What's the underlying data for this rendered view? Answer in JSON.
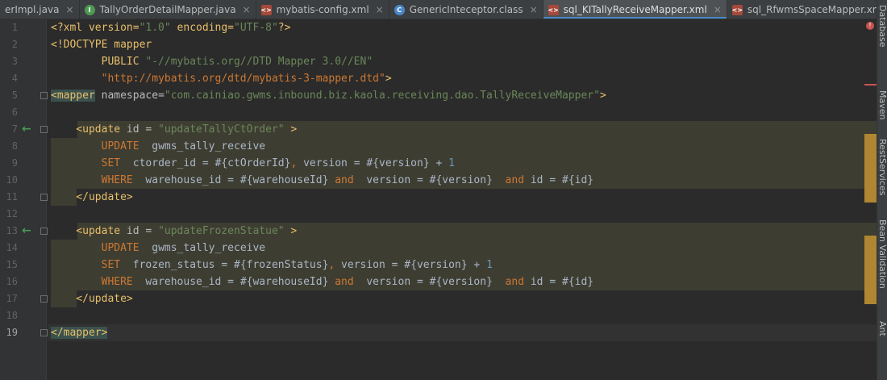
{
  "tabs": [
    {
      "label": "erImpl.java",
      "icon": "java-class-icon",
      "active": false
    },
    {
      "label": "TallyOrderDetailMapper.java",
      "icon": "java-interface-icon",
      "active": false
    },
    {
      "label": "mybatis-config.xml",
      "icon": "xml-file-icon",
      "active": false
    },
    {
      "label": "GenericInteceptor.class",
      "icon": "class-file-icon",
      "active": false
    },
    {
      "label": "sql_KITallyReceiveMapper.xml",
      "icon": "xml-file-icon",
      "active": true
    },
    {
      "label": "sql_RfwmsSpaceMapper.xml",
      "icon": "xml-file-icon",
      "active": false
    }
  ],
  "close_glyph": "×",
  "line_numbers": [
    "1",
    "2",
    "3",
    "4",
    "5",
    "6",
    "7",
    "8",
    "9",
    "10",
    "11",
    "12",
    "13",
    "14",
    "15",
    "16",
    "17",
    "18",
    "19"
  ],
  "code": {
    "l1": {
      "a": "<?xml version=",
      "b": "\"1.0\"",
      "c": " encoding=",
      "d": "\"UTF-8\"",
      "e": "?>"
    },
    "l2": {
      "a": "<!DOCTYPE mapper"
    },
    "l3": {
      "a": "        PUBLIC ",
      "b": "\"-//mybatis.org//DTD Mapper 3.0//EN\""
    },
    "l4": {
      "a": "        ",
      "b": "\"http://mybatis.org/dtd/mybatis-3-mapper.dtd\"",
      "c": ">"
    },
    "l5": {
      "a": "<mapper",
      "b": " namespace=",
      "c": "\"com.cainiao.gwms.inbound.biz.kaola.receiving.dao.TallyReceiveMapper\"",
      "d": ">"
    },
    "l7": {
      "a": "    <update",
      "b": " id ",
      "c": "= ",
      "d": "\"updateTallyCtOrder\"",
      "e": " >"
    },
    "l8": {
      "a": "        ",
      "b": "UPDATE",
      "c": "  gwms_tally_receive"
    },
    "l9": {
      "a": "        ",
      "b": "SET",
      "c": "  ctorder_id = #{ctOrderId}",
      "d": ",",
      "e": " version = #{version} + ",
      "f": "1"
    },
    "l10": {
      "a": "        ",
      "b": "WHERE",
      "c": "  warehouse_id = #{warehouseId} ",
      "d": "and",
      "e": "  version = #{version}  ",
      "f": "and",
      "g": " id = #{id}"
    },
    "l11": {
      "a": "    </update>"
    },
    "l13": {
      "a": "    <update",
      "b": " id ",
      "c": "= ",
      "d": "\"updateFrozenStatue\"",
      "e": " >"
    },
    "l14": {
      "a": "        ",
      "b": "UPDATE",
      "c": "  gwms_tally_receive"
    },
    "l15": {
      "a": "        ",
      "b": "SET",
      "c": "  frozen_status = #{frozenStatus}",
      "d": ",",
      "e": " version = #{version} + ",
      "f": "1"
    },
    "l16": {
      "a": "        ",
      "b": "WHERE",
      "c": "  warehouse_id = #{warehouseId} ",
      "d": "and",
      "e": "  version = #{version}  ",
      "f": "and",
      "g": " id = #{id}"
    },
    "l17": {
      "a": "    </update>"
    },
    "l19": {
      "a": "</mapper>"
    }
  },
  "right_panel": {
    "database": "Database",
    "maven": "Maven",
    "restservices": "RestServices",
    "bean_validation": "Bean Validation",
    "ant": "Ant"
  },
  "error_glyph": "!",
  "colors": {
    "background": "#2b2b2b",
    "tag": "#e8bf6a",
    "string": "#6a8759",
    "keyword": "#cc7832",
    "number": "#6897bb",
    "highlight": "#3e3d32",
    "active_tab_underline": "#4a88c7"
  }
}
